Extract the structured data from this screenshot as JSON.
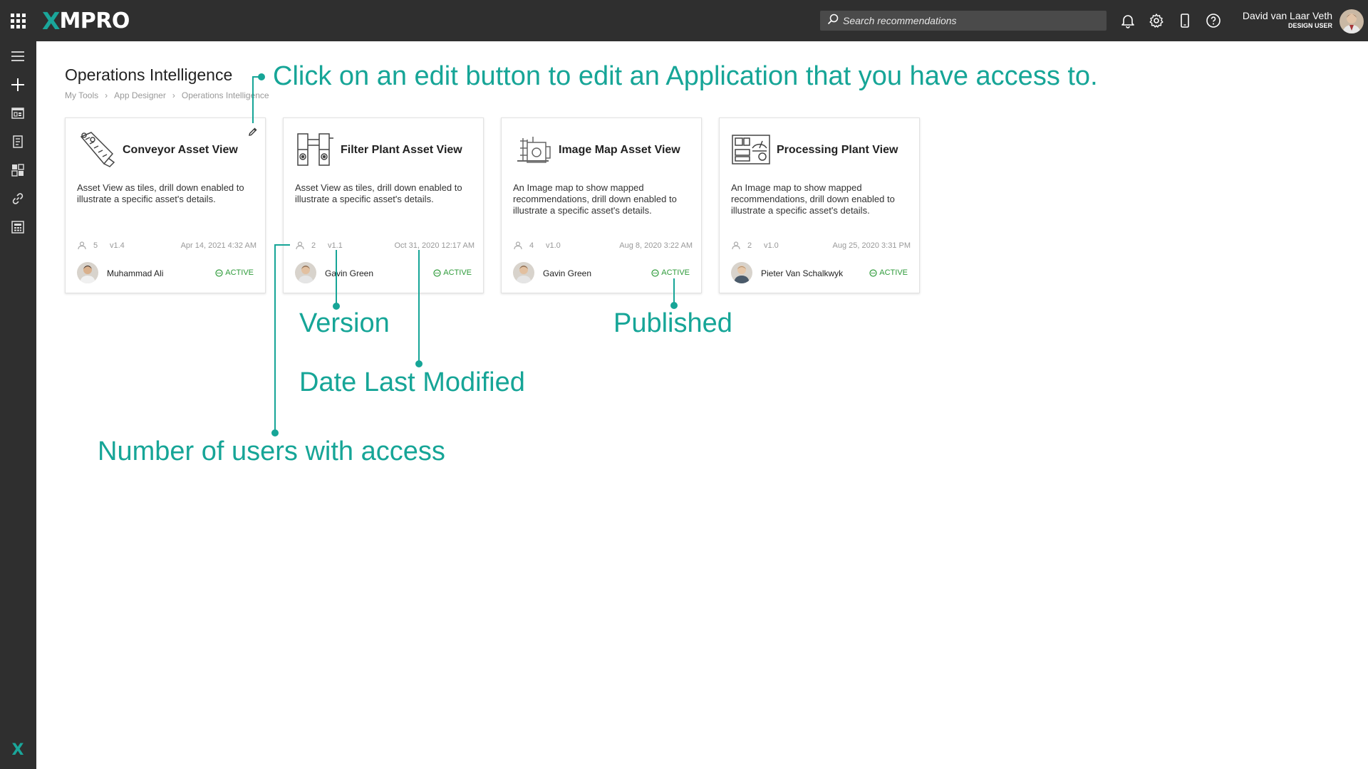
{
  "header": {
    "logo_x": "X",
    "logo_text": "MPRO",
    "search_placeholder": "Search recommendations",
    "user_name": "David van Laar Veth",
    "user_role": "DESIGN USER",
    "icons": [
      "apps-grid-icon",
      "search-icon",
      "bell-icon",
      "gear-icon",
      "mobile-icon",
      "help-icon"
    ]
  },
  "sidebar": {
    "items": [
      {
        "icon": "menu-icon"
      },
      {
        "icon": "plus-icon"
      },
      {
        "icon": "app-designer-icon"
      },
      {
        "icon": "data-stream-icon"
      },
      {
        "icon": "dashboard-icon"
      },
      {
        "icon": "link-icon"
      },
      {
        "icon": "calculator-icon"
      }
    ],
    "footer_logo": "X"
  },
  "page": {
    "title": "Operations Intelligence",
    "breadcrumb": [
      "My Tools",
      "App Designer",
      "Operations Intelligence"
    ]
  },
  "cards": [
    {
      "title": "Conveyor Asset View",
      "description": "Asset View as tiles, drill down enabled to illustrate a specific asset's details.",
      "users": "5",
      "version": "v1.4",
      "date": "Apr 14, 2021 4:32 AM",
      "owner": "Muhammad Ali",
      "status": "ACTIVE",
      "icon": "conveyor-icon"
    },
    {
      "title": "Filter Plant Asset View",
      "description": "Asset View as tiles, drill down enabled to illustrate a specific asset's details.",
      "users": "2",
      "version": "v1.1",
      "date": "Oct 31, 2020 12:17 AM",
      "owner": "Gavin Green",
      "status": "ACTIVE",
      "icon": "filter-plant-icon"
    },
    {
      "title": "Image Map Asset View",
      "description": "An Image map to show mapped recommendations, drill down enabled to illustrate a specific asset's details.",
      "users": "4",
      "version": "v1.0",
      "date": "Aug 8, 2020 3:22 AM",
      "owner": "Gavin Green",
      "status": "ACTIVE",
      "icon": "image-map-icon"
    },
    {
      "title": "Processing Plant View",
      "description": "An Image map to show mapped recommendations, drill down enabled to illustrate a specific asset's details.",
      "users": "2",
      "version": "v1.0",
      "date": "Aug 25, 2020 3:31 PM",
      "owner": "Pieter Van Schalkwyk",
      "status": "ACTIVE",
      "icon": "processing-plant-icon"
    }
  ],
  "annotations": {
    "edit": "Click on an edit button to edit an Application that you have access to.",
    "version": "Version",
    "published": "Published",
    "date_modified": "Date Last Modified",
    "users": "Number of users with access"
  },
  "colors": {
    "topbar": "#2f2f2f",
    "accent": "#16a597",
    "active_status": "#2e9b3a"
  }
}
